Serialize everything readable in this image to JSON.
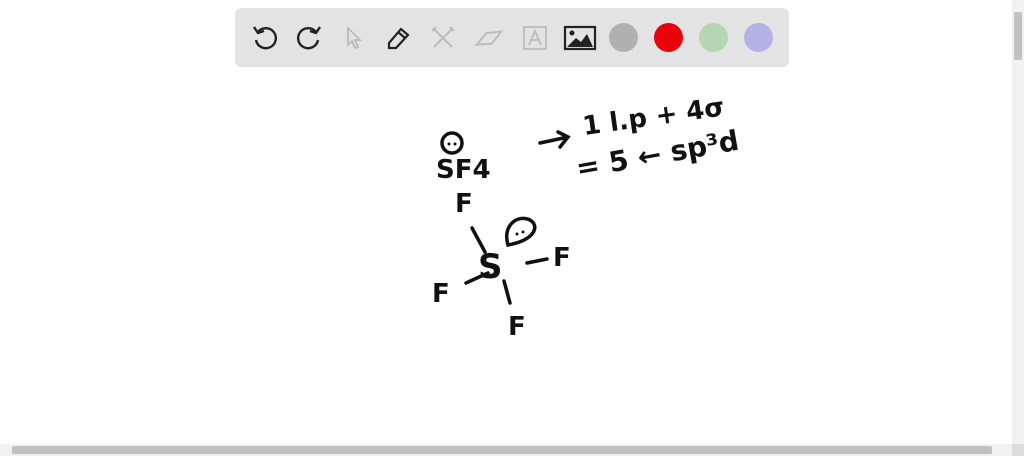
{
  "toolbar": {
    "tools": [
      "undo",
      "redo",
      "select",
      "pen",
      "tools",
      "eraser",
      "text",
      "image"
    ],
    "colors": {
      "gray": "#b0b0b0",
      "red": "#e8000b",
      "green": "#b5d6b2",
      "purple": "#b3b1e6"
    }
  },
  "canvas": {
    "formula": "SF4",
    "line1": "1 l.p + 4σ",
    "line2": "= 5 ← sp³d",
    "atom_f": "F",
    "atom_s": "S"
  }
}
